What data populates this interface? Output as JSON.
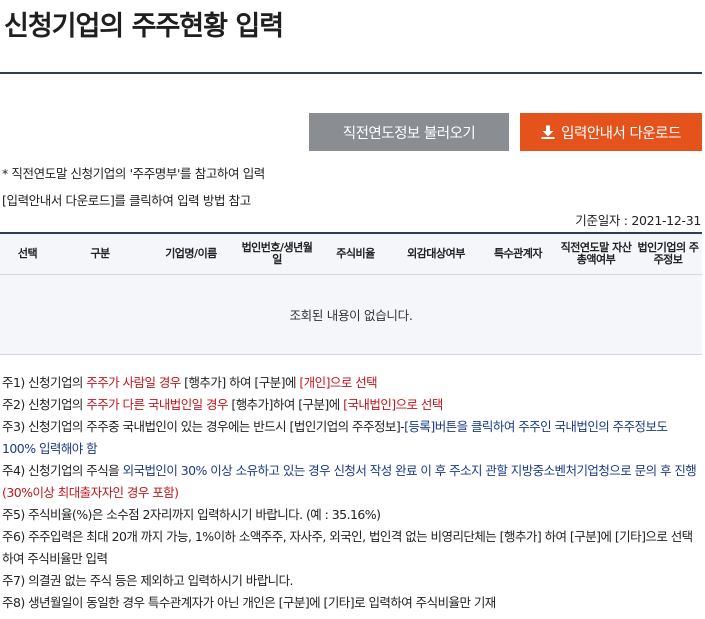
{
  "page": {
    "title": "신청기업의 주주현황 입력"
  },
  "toolbar": {
    "load_prev_label": "직전연도정보 불러오기",
    "download_guide_label": "입력안내서 다운로드"
  },
  "notes": {
    "line1": "* 직전연도말 신청기업의 '주주명부'를 참고하여 입력",
    "line2": "[입력안내서 다운로드]를 클릭하여 입력 방법 참고",
    "base_date": "기준일자 : 2021-12-31"
  },
  "grid": {
    "columns": [
      "선택",
      "구분",
      "기업명/이름",
      "법인번호/생년월일",
      "주식비율",
      "외감대상여부",
      "특수관계자",
      "직전연도말 자산총액여부",
      "법인기업의 주주정보"
    ],
    "empty_message": "조회된 내용이 없습니다."
  },
  "notices": {
    "n1": {
      "a": "주1) 신청기업의 ",
      "b": "주주가 사람일 경우",
      "c": " [행추가] 하여 [구분]에 ",
      "d": "[개인]으로 선택"
    },
    "n2": {
      "a": "주2) 신청기업의 ",
      "b": "주주가 다른 국내법인일 경우",
      "c": " [행추가]하여 [구분]에 ",
      "d": "[국내법인]으로 선택"
    },
    "n3": {
      "a": "주3) 신청기업의 주주중 국내법인이 있는 경우에는 반드시 [법인기업의 주주정보]-",
      "b": "[등록]버튼을 클릭하여 주주인 국내법인의 주주정보도 100% 입력해야 함"
    },
    "n4": {
      "a": "주4) 신청기업의 주식을 ",
      "b": "외국법인이 30% 이상 소유하고 있는 경우 신청서 작성 완료 이 후 주소지 관할 지방중소벤처기업청으로 문의 후 진행",
      "c": "(30%이상 최대출자자인 경우 포함)"
    },
    "n5": "주5) 주식비율(%)은 소수점 2자리까지 입력하시기 바랍니다. (예 : 35.16%)",
    "n6": "주6) 주주입력은 최대 20개 까지 가능, 1%이하 소액주주, 자사주, 외국인, 법인격 없는 비영리단체는 [행추가] 하여 [구분]에 [기타]으로 선택하여 주식비율만 입력",
    "n7": "주7) 의결권 없는 주식 등은 제외하고 입력하시기 바랍니다.",
    "n8": "주8) 생년월일이 동일한 경우 특수관계자가 아닌 개인은 [구분]에 [기타]로 입력하여 주식비율만 기재"
  },
  "icons": {
    "download": "download-icon"
  },
  "colors": {
    "title_rule": "#2c3e55",
    "load_button": "#8a8e93",
    "download_button": "#e4531b",
    "emphasis_red": "#c4161c",
    "emphasis_blue": "#1c3a8a",
    "grid_background": "#f4f6f9"
  }
}
